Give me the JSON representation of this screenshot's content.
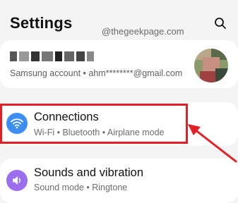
{
  "header": {
    "title": "Settings",
    "search_icon": "search-icon"
  },
  "watermark": "@thegeekpage.com",
  "account": {
    "name_redacted": true,
    "subtitle": "Samsung account  •  ahm********@gmail.com",
    "avatar": "avatar"
  },
  "items": [
    {
      "title": "Connections",
      "subtitle": "Wi-Fi  •  Bluetooth  •  Airplane mode",
      "icon": "wifi-icon",
      "icon_color": "#3d8ef2",
      "highlighted": true
    },
    {
      "title": "Sounds and vibration",
      "subtitle": "Sound mode  •  Ringtone",
      "icon": "speaker-icon",
      "icon_color": "#9b6df0"
    }
  ],
  "annotation": {
    "highlight_color": "#e31e24",
    "arrow_color": "#e31e24"
  }
}
